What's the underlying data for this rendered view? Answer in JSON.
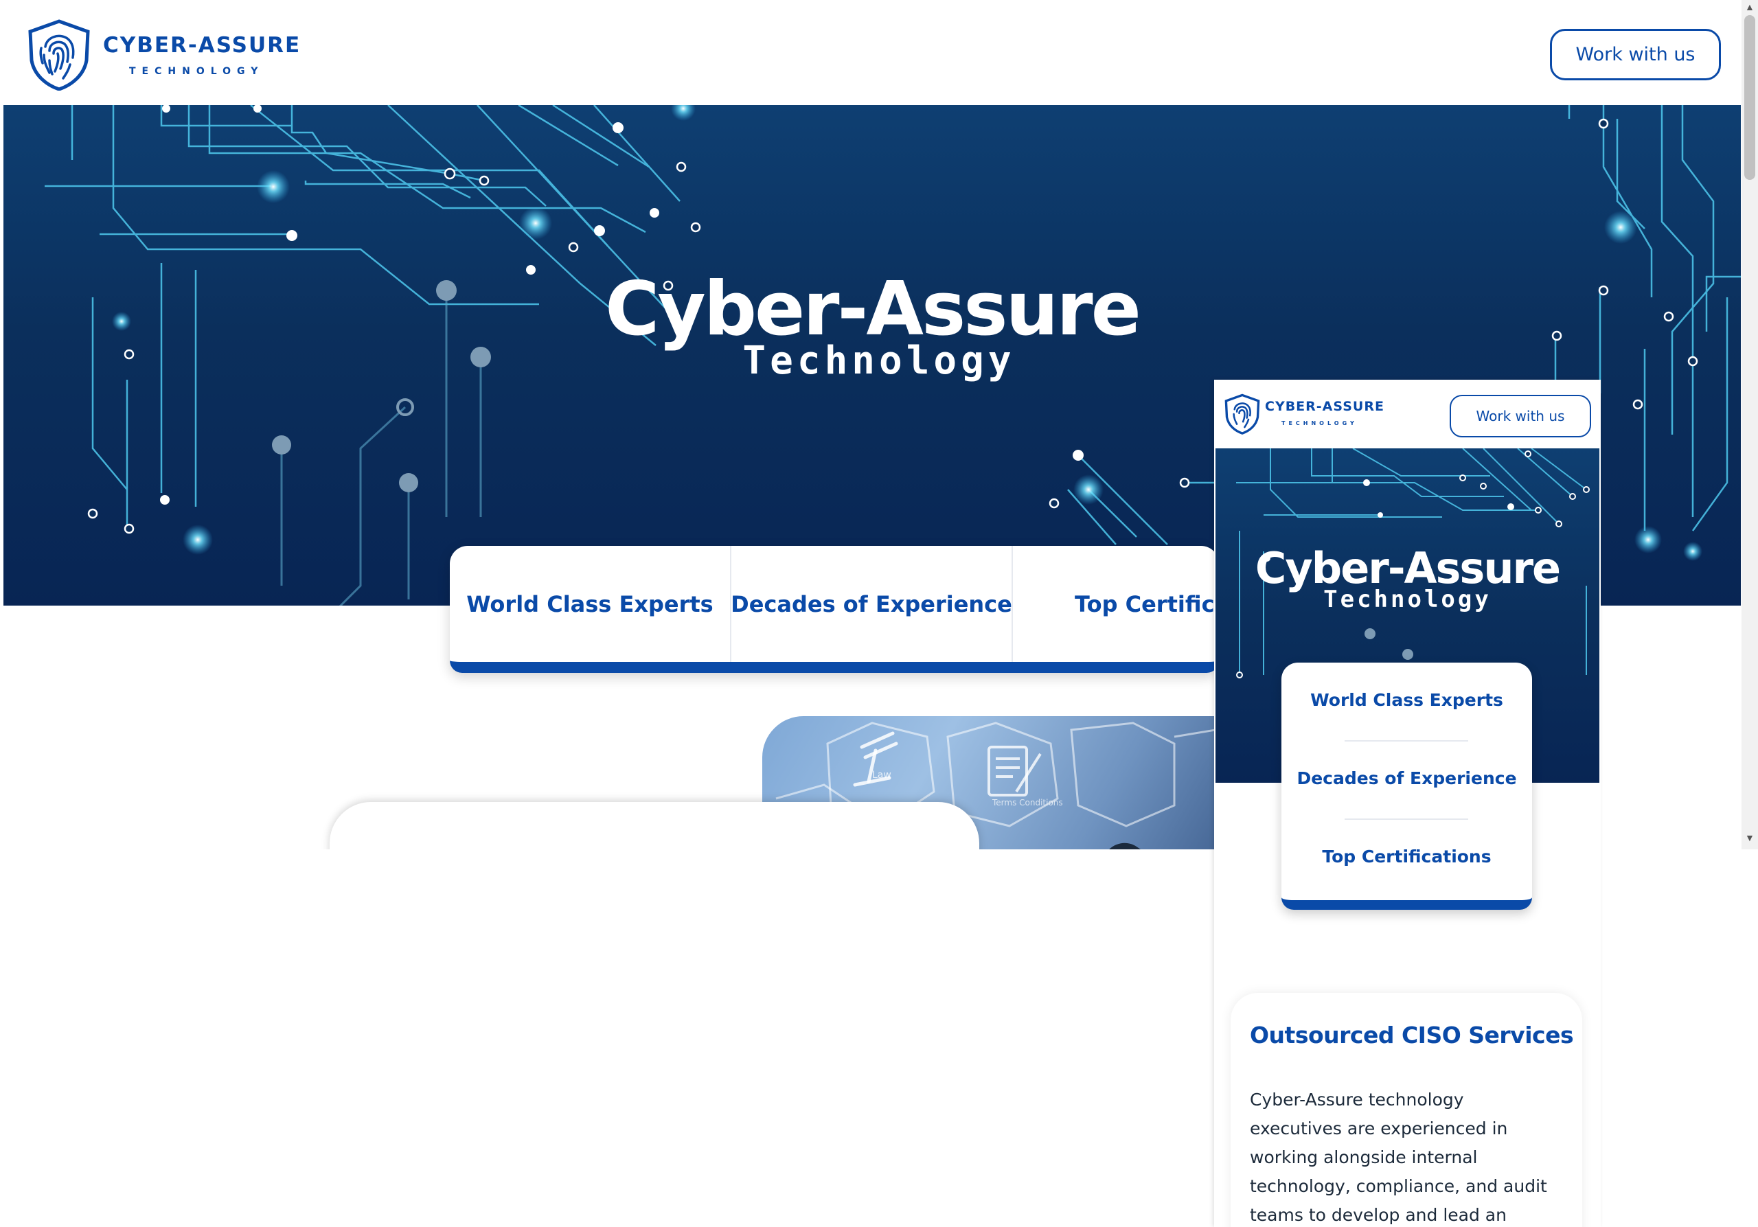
{
  "desktop": {
    "header": {
      "logo_name": "CYBER-ASSURE",
      "logo_sub": "TECHNOLOGY",
      "cta_label": "Work with us"
    },
    "hero": {
      "title": "Cyber-Assure",
      "subtitle": "Technology"
    },
    "features": [
      "World Class Experts",
      "Decades of Experience",
      "Top Certifications"
    ],
    "image_labels": [
      "Law",
      "Terms Conditions"
    ]
  },
  "mobile": {
    "header": {
      "logo_name": "CYBER-ASSURE",
      "logo_sub": "TECHNOLOGY",
      "cta_label": "Work with us"
    },
    "hero": {
      "title": "Cyber-Assure",
      "subtitle": "Technology"
    },
    "features": [
      "World Class Experts",
      "Decades of Experience",
      "Top Certifications"
    ],
    "service": {
      "title": "Outsourced CISO Services",
      "text": "Cyber-Assure technology executives are experienced in working alongside internal technology, compliance, and audit teams to develop and lead an"
    }
  },
  "colors": {
    "brand": "#0a4aa8",
    "hero_dark": "#082554",
    "hero_mid": "#0e3f72",
    "circuit": "#4fd6f5"
  },
  "icons": [
    "fingerprint-shield-icon",
    "gavel-icon",
    "document-icon",
    "scroll-up-arrow-icon",
    "scroll-down-arrow-icon"
  ]
}
